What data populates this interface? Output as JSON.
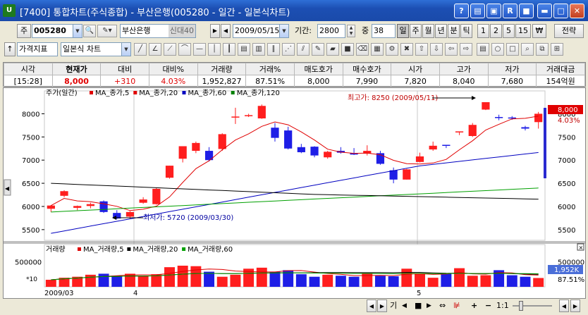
{
  "window": {
    "title": "[7400] 통합차트(주식종합) - 부산은행(005280 - 일간 - 일본식차트)",
    "app_icon": "U",
    "buttons": [
      "?",
      "▤",
      "▣",
      "R",
      "■",
      "▬",
      "□",
      "✕"
    ]
  },
  "toolbar1": {
    "market_btn": "주",
    "code": "005280",
    "name": "부산은행",
    "credit": "신대40",
    "date": "2009/05/15",
    "period_label": "기간:",
    "period_value": "2800",
    "count_prefix": "중",
    "count_value": "38",
    "intervals": [
      "일",
      "주",
      "월",
      "년",
      "분",
      "틱",
      "1",
      "2",
      "5",
      "15"
    ],
    "selected_interval": "일",
    "currency_btn": "₩",
    "strategy_btn": "전략"
  },
  "toolbar2": {
    "indicator_btn": "가격지표",
    "chart_type": "일본식 차트"
  },
  "quote": {
    "headers": [
      "시각",
      "현재가",
      "대비",
      "대비%",
      "거래량",
      "거래%",
      "매도호가",
      "매수호가",
      "시가",
      "고가",
      "저가",
      "거래대금"
    ],
    "values": [
      "[15:28]",
      "8,000",
      "+310",
      "4.03%",
      "1,952,827",
      "87.51%",
      "8,000",
      "7,990",
      "7,820",
      "8,040",
      "7,680",
      "154억원"
    ]
  },
  "price_panel": {
    "legend": "주가(일간)",
    "ma_legend": [
      {
        "label": "MA_종가,5",
        "color": "#e00000"
      },
      {
        "label": "MA_종가,20",
        "color": "#e00000"
      },
      {
        "label": "MA_종가,60",
        "color": "#0000c0"
      },
      {
        "label": "MA_종가,120",
        "color": "#008000"
      }
    ],
    "y_ticks": [
      "8000",
      "7500",
      "7000",
      "6500",
      "6000",
      "5500"
    ],
    "high_note": "최고가: 8250 (2009/05/11)",
    "low_note": "최저가: 5720 (2009/03/30)",
    "current_price_tag": "8,000",
    "current_pct": "4.03%"
  },
  "volume_panel": {
    "legend": "거래량",
    "ma_legend": [
      {
        "label": "MA_거래량,5",
        "color": "#e00000"
      },
      {
        "label": "MA_거래량,20",
        "color": "#000000"
      },
      {
        "label": "MA_거래량,60",
        "color": "#00a000"
      }
    ],
    "y_tick": "500000",
    "unit": "*10",
    "current_tag": "1,952K",
    "current_pct": "87.51%"
  },
  "x_labels": [
    "2009/03",
    "4",
    "5"
  ],
  "bottom_controls": [
    "◀",
    "▶",
    "기",
    "◀",
    "■",
    "▶",
    "⇔",
    "⊯",
    "+",
    "−",
    "1:1",
    "◀",
    "▶"
  ],
  "chart_data": {
    "type": "candlestick",
    "ylim": [
      5300,
      8250
    ],
    "candles": [
      {
        "o": 5950,
        "h": 6030,
        "l": 5880,
        "c": 6020
      },
      {
        "o": 6230,
        "h": 6350,
        "l": 6200,
        "c": 6330
      },
      {
        "o": 5970,
        "h": 6020,
        "l": 5920,
        "c": 6010
      },
      {
        "o": 6010,
        "h": 6080,
        "l": 5960,
        "c": 6050
      },
      {
        "o": 6110,
        "h": 6130,
        "l": 5860,
        "c": 5880
      },
      {
        "o": 5860,
        "h": 5920,
        "l": 5720,
        "c": 5740
      },
      {
        "o": 5780,
        "h": 5900,
        "l": 5740,
        "c": 5880
      },
      {
        "o": 6080,
        "h": 6200,
        "l": 6060,
        "c": 6150
      },
      {
        "o": 6050,
        "h": 6400,
        "l": 6040,
        "c": 6380
      },
      {
        "o": 6620,
        "h": 6880,
        "l": 6600,
        "c": 6880
      },
      {
        "o": 7030,
        "h": 7300,
        "l": 6950,
        "c": 7300
      },
      {
        "o": 7200,
        "h": 7400,
        "l": 7150,
        "c": 7370
      },
      {
        "o": 7200,
        "h": 7280,
        "l": 6970,
        "c": 7000
      },
      {
        "o": 7240,
        "h": 7580,
        "l": 7200,
        "c": 7560
      },
      {
        "o": 7920,
        "h": 8130,
        "l": 7780,
        "c": 7940
      },
      {
        "o": 7950,
        "h": 8000,
        "l": 7930,
        "c": 7970
      },
      {
        "o": 7900,
        "h": 8200,
        "l": 7890,
        "c": 8170
      },
      {
        "o": 7700,
        "h": 7800,
        "l": 7400,
        "c": 7480
      },
      {
        "o": 7640,
        "h": 7720,
        "l": 7230,
        "c": 7250
      },
      {
        "o": 7280,
        "h": 7350,
        "l": 7150,
        "c": 7170
      },
      {
        "o": 7290,
        "h": 7300,
        "l": 7060,
        "c": 7100
      },
      {
        "o": 7060,
        "h": 7200,
        "l": 7030,
        "c": 7180
      },
      {
        "o": 7200,
        "h": 7280,
        "l": 7140,
        "c": 7160
      },
      {
        "o": 7150,
        "h": 7260,
        "l": 7110,
        "c": 7120
      },
      {
        "o": 7140,
        "h": 7320,
        "l": 7100,
        "c": 7200
      },
      {
        "o": 7150,
        "h": 7200,
        "l": 6900,
        "c": 6920
      },
      {
        "o": 6780,
        "h": 6840,
        "l": 6500,
        "c": 6580
      },
      {
        "o": 6580,
        "h": 6810,
        "l": 6580,
        "c": 6800
      },
      {
        "o": 6960,
        "h": 7160,
        "l": 6950,
        "c": 7080
      },
      {
        "o": 7230,
        "h": 7400,
        "l": 7200,
        "c": 7310
      },
      {
        "o": 7330,
        "h": 7330,
        "l": 7260,
        "c": 7310
      },
      {
        "o": 7600,
        "h": 7620,
        "l": 7540,
        "c": 7620
      },
      {
        "o": 7520,
        "h": 7800,
        "l": 7500,
        "c": 7760
      },
      {
        "o": 8090,
        "h": 8250,
        "l": 8080,
        "c": 8250
      },
      {
        "o": 7930,
        "h": 7980,
        "l": 7860,
        "c": 7920
      },
      {
        "o": 7920,
        "h": 7950,
        "l": 7870,
        "c": 7900
      },
      {
        "o": 7710,
        "h": 7740,
        "l": 7640,
        "c": 7680
      },
      {
        "o": 7820,
        "h": 8040,
        "l": 7680,
        "c": 8000
      }
    ],
    "volumes": [
      140,
      180,
      200,
      240,
      260,
      220,
      260,
      210,
      250,
      390,
      420,
      410,
      300,
      200,
      240,
      360,
      380,
      300,
      330,
      250,
      200,
      240,
      220,
      200,
      260,
      220,
      210,
      360,
      260,
      180,
      260,
      370,
      220,
      230,
      330,
      230,
      200,
      175
    ],
    "vol_ylim": [
      0,
      700
    ]
  },
  "colors": {
    "up": "#ff1e1e",
    "down": "#1e1ee6",
    "ma5": "#e00000",
    "ma20": "#000000",
    "ma60": "#0000c0",
    "ma120": "#00a000"
  }
}
